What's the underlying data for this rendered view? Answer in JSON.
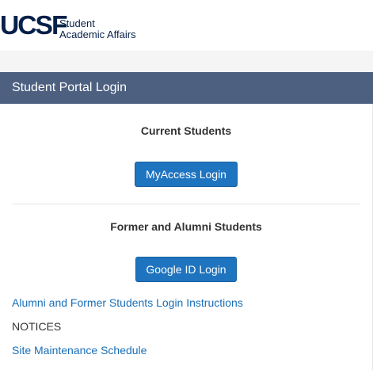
{
  "header": {
    "logo_mark": "UCSF",
    "logo_line1": "Student",
    "logo_line2": "Academic Affairs"
  },
  "panel": {
    "title": "Student Portal Login"
  },
  "current_students": {
    "heading": "Current Students",
    "button_label": "MyAccess Login"
  },
  "former_students": {
    "heading": "Former and Alumni Students",
    "button_label": "Google ID Login"
  },
  "links": {
    "alumni_instructions": "Alumni and Former Students Login Instructions",
    "notices_label": "NOTICES",
    "site_maintenance": "Site Maintenance Schedule"
  },
  "colors": {
    "brand_navy": "#052049",
    "panel_heading_bg": "#4d6080",
    "button_bg": "#1f74c0",
    "link": "#1a6fb7"
  }
}
